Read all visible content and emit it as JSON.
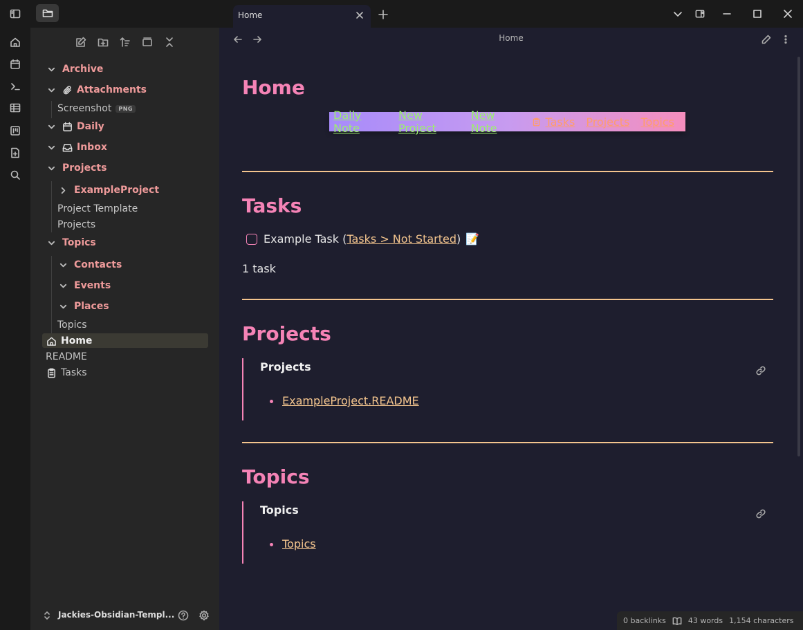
{
  "ribbon": {
    "icons": [
      "sidebar-toggle-icon",
      "home-icon",
      "calendar-icon",
      "terminal-icon",
      "table-icon",
      "kanban-icon",
      "new-file-icon",
      "search-icon"
    ]
  },
  "file_explorer": {
    "toolbar": [
      "new-note-icon",
      "new-folder-icon",
      "sort-icon",
      "collapse-view-icon",
      "collapse-all-icon"
    ],
    "tree": [
      {
        "label": "Archive",
        "type": "folder"
      },
      {
        "label": "Attachments",
        "type": "folder",
        "icon": "paperclip-icon"
      },
      {
        "label": "Screenshot",
        "type": "file",
        "badge": "PNG"
      },
      {
        "label": "Daily",
        "type": "folder",
        "icon": "calendar-icon"
      },
      {
        "label": "Inbox",
        "type": "folder",
        "icon": "inbox-icon"
      },
      {
        "label": "Projects",
        "type": "folder"
      },
      {
        "label": "ExampleProject",
        "type": "folder",
        "collapsed": true
      },
      {
        "label": "Project Template",
        "type": "file"
      },
      {
        "label": "Projects",
        "type": "file"
      },
      {
        "label": "Topics",
        "type": "folder"
      },
      {
        "label": "Contacts",
        "type": "folder"
      },
      {
        "label": "Events",
        "type": "folder"
      },
      {
        "label": "Places",
        "type": "folder"
      },
      {
        "label": "Topics",
        "type": "file"
      },
      {
        "label": "Home",
        "type": "file",
        "icon": "home-icon",
        "active": true
      },
      {
        "label": "README",
        "type": "file"
      },
      {
        "label": "Tasks",
        "type": "file",
        "icon": "clipboard-icon"
      }
    ],
    "vault_name": "Jackies-Obsidian-Templ..."
  },
  "tabs": [
    {
      "title": "Home",
      "active": true
    }
  ],
  "view": {
    "title": "Home"
  },
  "note": {
    "title": "Home",
    "nav_links": [
      {
        "label": "Daily Note",
        "color": "#9cf06e"
      },
      {
        "label": "New Project",
        "color": "#9cf06e"
      },
      {
        "label": "New Note",
        "color": "#9cf06e"
      },
      {
        "label": "Tasks",
        "color": "#ff9d6b",
        "icon": "clipboard-icon"
      },
      {
        "label": "Projects",
        "color": "#ff9d6b"
      },
      {
        "label": "Topics",
        "color": "#ff9d6b"
      }
    ],
    "tasks_heading": "Tasks",
    "task": {
      "text": "Example Task (",
      "link": "Tasks > Not Started",
      "close": ")",
      "emoji": "📝",
      "checked": false
    },
    "task_count": "1 task",
    "projects_heading": "Projects",
    "projects_embed": {
      "title": "Projects",
      "item": "ExampleProject.README"
    },
    "topics_heading": "Topics",
    "topics_embed": {
      "title": "Topics",
      "item": "Topics"
    }
  },
  "status_bar": {
    "backlinks": "0 backlinks",
    "words": "43 words",
    "characters": "1,154 characters"
  },
  "colors": {
    "heading": "#f583b6",
    "folder": "#ee9a9a",
    "link": "#f4c58e",
    "divider": "#f4c58e",
    "nav_green": "#9cf06e",
    "nav_orange": "#ff9d6b"
  }
}
